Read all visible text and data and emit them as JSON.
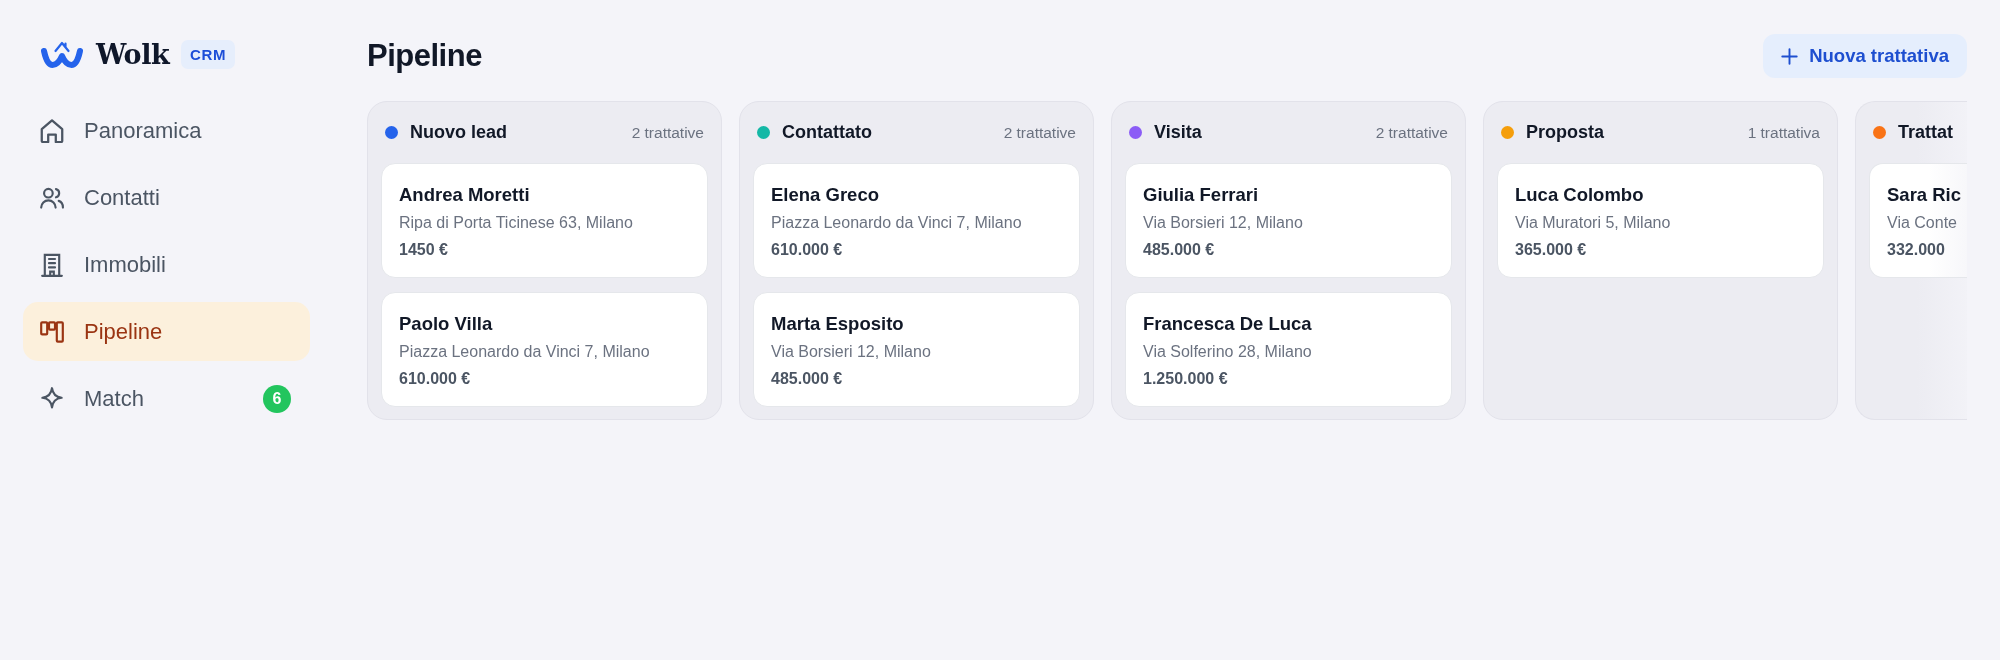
{
  "sidebar": {
    "logo": {
      "name": "Wolk",
      "badge": "CRM"
    },
    "items": [
      {
        "label": "Panoramica",
        "selected": false
      },
      {
        "label": "Contatti",
        "selected": false
      },
      {
        "label": "Immobili",
        "selected": false
      },
      {
        "label": "Pipeline",
        "selected": true
      },
      {
        "label": "Match",
        "selected": false,
        "badge": "6"
      }
    ]
  },
  "header": {
    "title": "Pipeline",
    "button": {
      "label": "Nuova trattativa"
    }
  },
  "board": {
    "columns": [
      {
        "title": "Nuovo lead",
        "color": "#2563eb",
        "count": "2 trattative",
        "cards": [
          {
            "name": "Andrea Moretti",
            "address": "Ripa di Porta Ticinese 63, Milano",
            "price": "1450 €"
          },
          {
            "name": "Paolo Villa",
            "address": "Piazza Leonardo da Vinci 7, Milano",
            "price": "610.000 €"
          }
        ]
      },
      {
        "title": "Contattato",
        "color": "#14b8a6",
        "count": "2 trattative",
        "cards": [
          {
            "name": "Elena Greco",
            "address": "Piazza Leonardo da Vinci 7, Milano",
            "price": "610.000 €"
          },
          {
            "name": "Marta Esposito",
            "address": "Via Borsieri 12, Milano",
            "price": "485.000 €"
          }
        ]
      },
      {
        "title": "Visita",
        "color": "#8b5cf6",
        "count": "2 trattative",
        "cards": [
          {
            "name": "Giulia Ferrari",
            "address": "Via Borsieri 12, Milano",
            "price": "485.000 €"
          },
          {
            "name": "Francesca De Luca",
            "address": "Via Solferino 28, Milano",
            "price": "1.250.000 €"
          }
        ]
      },
      {
        "title": "Proposta",
        "color": "#f59e0b",
        "count": "1 trattativa",
        "cards": [
          {
            "name": "Luca Colombo",
            "address": "Via Muratori 5, Milano",
            "price": "365.000 €"
          }
        ]
      },
      {
        "title": "Trattat",
        "color": "#f97316",
        "cards": [
          {
            "name": "Sara Ric",
            "address": "Via Conte",
            "price": "332.000"
          }
        ]
      }
    ]
  }
}
